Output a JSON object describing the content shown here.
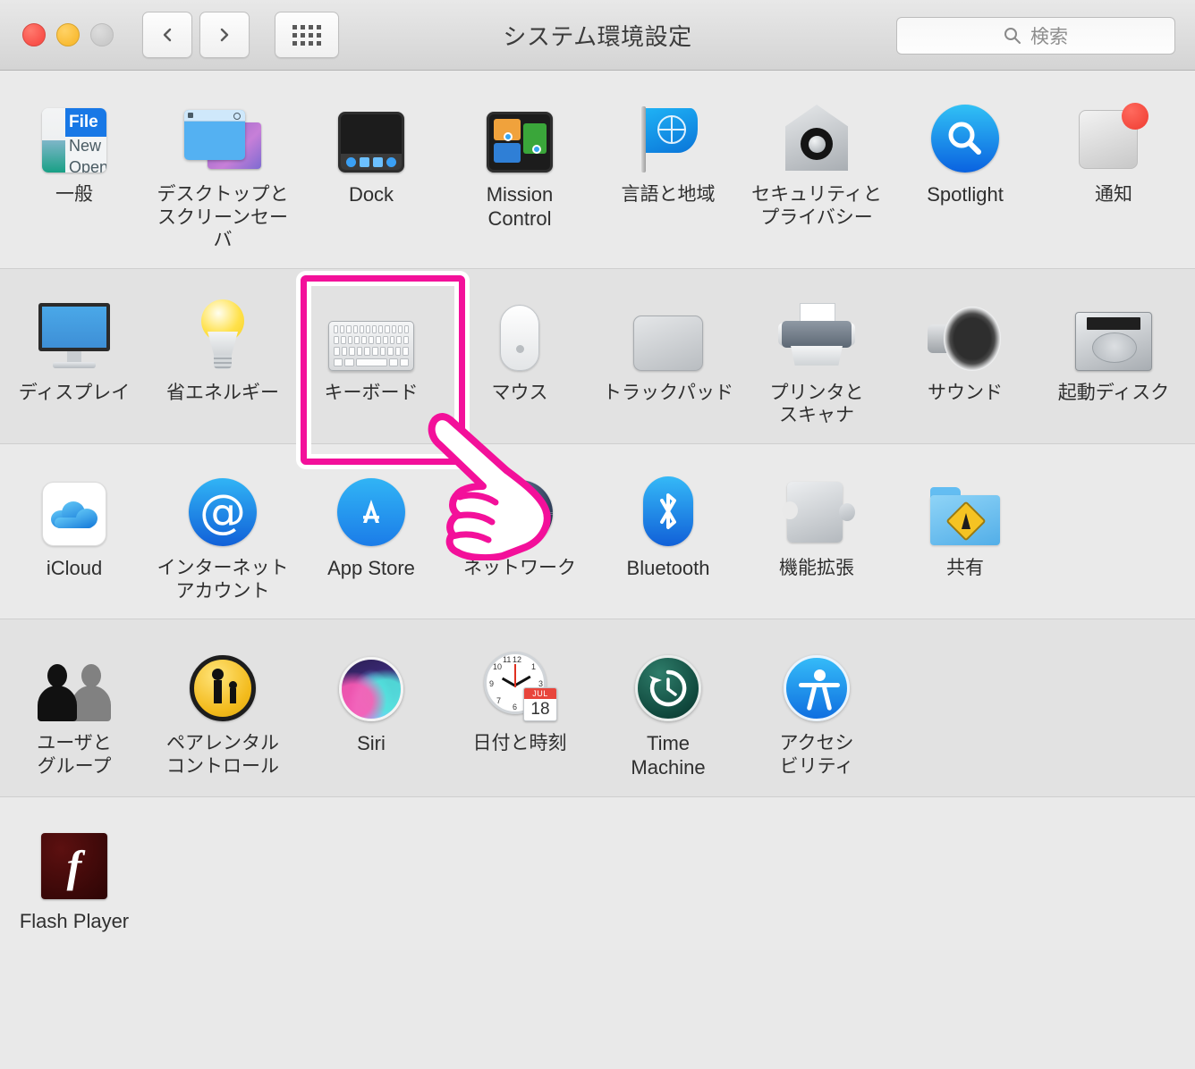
{
  "window": {
    "title": "システム環境設定",
    "traffic_lights": [
      "close",
      "minimize",
      "zoom"
    ],
    "back_label": "戻る",
    "forward_label": "進む",
    "grid_label": "すべてを表示"
  },
  "search": {
    "placeholder": "検索",
    "value": "",
    "icon": "search-icon"
  },
  "highlight": {
    "target": "キーボード",
    "color": "#f3109a",
    "cursor": "pointing-hand-cursor"
  },
  "rows": [
    {
      "band": "a",
      "items": [
        {
          "label": "一般",
          "icon": "general-icon",
          "lang": "ja",
          "menu": {
            "file": "File",
            "new": "New",
            "open": "Open"
          }
        },
        {
          "label": "デスクトップと\nスクリーンセーバ",
          "icon": "desktop-screensaver-icon",
          "lang": "ja"
        },
        {
          "label": "Dock",
          "icon": "dock-icon",
          "lang": "en"
        },
        {
          "label": "Mission\nControl",
          "icon": "mission-control-icon",
          "lang": "en"
        },
        {
          "label": "言語と地域",
          "icon": "language-region-icon",
          "lang": "ja"
        },
        {
          "label": "セキュリティと\nプライバシー",
          "icon": "security-privacy-icon",
          "lang": "ja"
        },
        {
          "label": "Spotlight",
          "icon": "spotlight-icon",
          "lang": "en"
        },
        {
          "label": "通知",
          "icon": "notifications-icon",
          "lang": "ja"
        }
      ]
    },
    {
      "band": "b",
      "items": [
        {
          "label": "ディスプレイ",
          "icon": "display-icon",
          "lang": "ja"
        },
        {
          "label": "省エネルギー",
          "icon": "energy-saver-icon",
          "lang": "ja"
        },
        {
          "label": "キーボード",
          "icon": "keyboard-icon",
          "lang": "ja",
          "highlighted": true
        },
        {
          "label": "マウス",
          "icon": "mouse-icon",
          "lang": "ja"
        },
        {
          "label": "トラックパッド",
          "icon": "trackpad-icon",
          "lang": "ja"
        },
        {
          "label": "プリンタと\nスキャナ",
          "icon": "printers-scanners-icon",
          "lang": "ja"
        },
        {
          "label": "サウンド",
          "icon": "sound-icon",
          "lang": "ja"
        },
        {
          "label": "起動ディスク",
          "icon": "startup-disk-icon",
          "lang": "ja"
        }
      ]
    },
    {
      "band": "a",
      "items": [
        {
          "label": "iCloud",
          "icon": "icloud-icon",
          "lang": "en"
        },
        {
          "label": "インターネット\nアカウント",
          "icon": "internet-accounts-icon",
          "lang": "ja"
        },
        {
          "label": "App Store",
          "icon": "app-store-icon",
          "lang": "en"
        },
        {
          "label": "ネットワーク",
          "icon": "network-icon",
          "lang": "ja"
        },
        {
          "label": "Bluetooth",
          "icon": "bluetooth-icon",
          "lang": "en"
        },
        {
          "label": "機能拡張",
          "icon": "extensions-icon",
          "lang": "ja"
        },
        {
          "label": "共有",
          "icon": "sharing-icon",
          "lang": "ja"
        }
      ]
    },
    {
      "band": "b",
      "items": [
        {
          "label": "ユーザと\nグループ",
          "icon": "users-groups-icon",
          "lang": "ja"
        },
        {
          "label": "ペアレンタル\nコントロール",
          "icon": "parental-controls-icon",
          "lang": "ja"
        },
        {
          "label": "Siri",
          "icon": "siri-icon",
          "lang": "en"
        },
        {
          "label": "日付と時刻",
          "icon": "date-time-icon",
          "lang": "ja",
          "calendar": {
            "month": "JUL",
            "day": "18"
          }
        },
        {
          "label": "Time\nMachine",
          "icon": "time-machine-icon",
          "lang": "en"
        },
        {
          "label": "アクセシ\nビリティ",
          "icon": "accessibility-icon",
          "lang": "ja"
        }
      ]
    },
    {
      "band": "a",
      "items": [
        {
          "label": "Flash Player",
          "icon": "flash-player-icon",
          "lang": "en",
          "glyph": "f"
        }
      ]
    }
  ]
}
